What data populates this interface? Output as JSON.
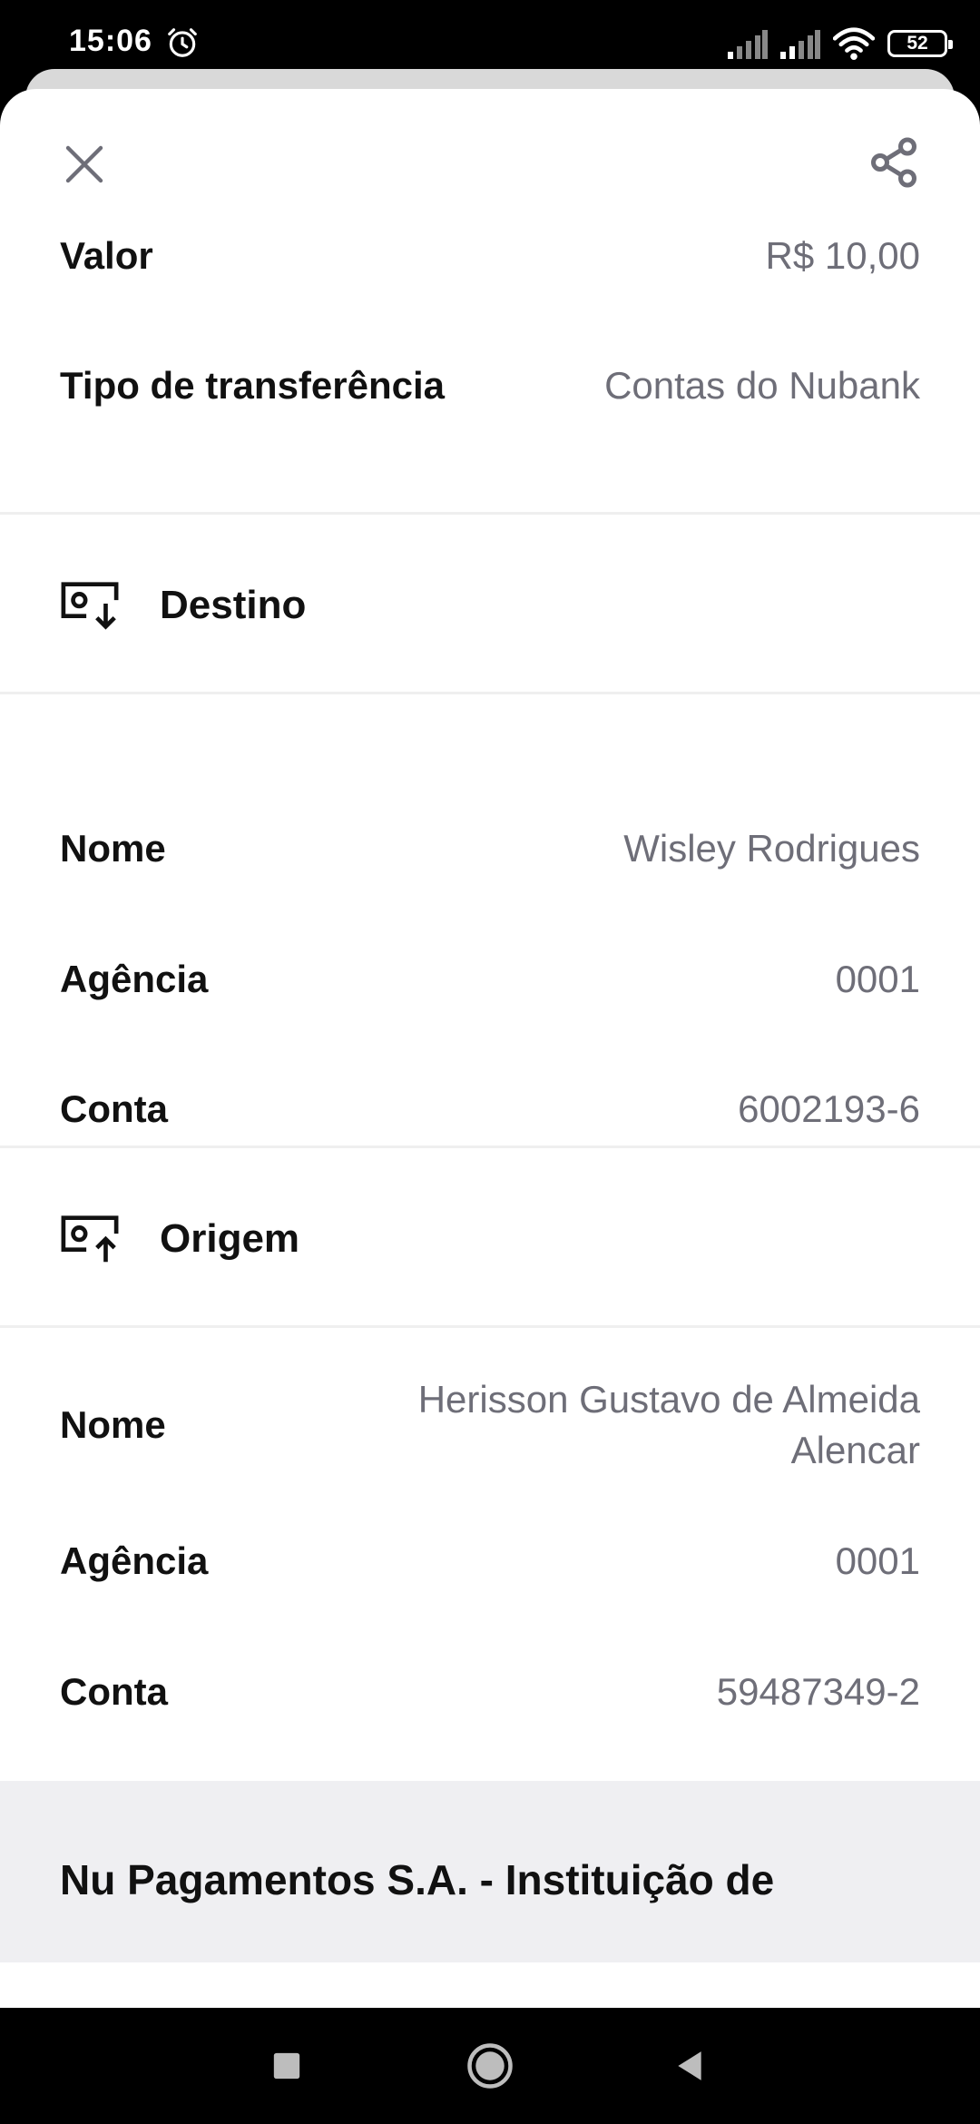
{
  "status_bar": {
    "time": "15:06",
    "battery": "52",
    "icons": [
      "alarm-icon",
      "cellular-signal-icon",
      "cellular-signal-icon",
      "wifi-icon",
      "battery-icon"
    ]
  },
  "header": {
    "close_icon": "close-icon",
    "share_icon": "share-icon"
  },
  "summary": {
    "valor_label": "Valor",
    "valor_value": "R$ 10,00",
    "tipo_label": "Tipo de transferência",
    "tipo_value": "Contas do Nubank"
  },
  "destino": {
    "title": "Destino",
    "icon": "money-receive-icon",
    "nome_label": "Nome",
    "nome_value": "Wisley Rodrigues",
    "agencia_label": "Agência",
    "agencia_value": "0001",
    "conta_label": "Conta",
    "conta_value": "6002193-6"
  },
  "origem": {
    "title": "Origem",
    "icon": "money-send-icon",
    "nome_label": "Nome",
    "nome_value": "Herisson Gustavo de Almeida Alencar",
    "agencia_label": "Agência",
    "agencia_value": "0001",
    "conta_label": "Conta",
    "conta_value": "59487349-2"
  },
  "footer": {
    "text": "Nu Pagamentos S.A. - Instituição de"
  },
  "colors": {
    "label": "#111111",
    "value": "#6e6e78",
    "divider": "#efefef",
    "footer_bg": "#efeff2",
    "icon": "#6e6e78"
  }
}
